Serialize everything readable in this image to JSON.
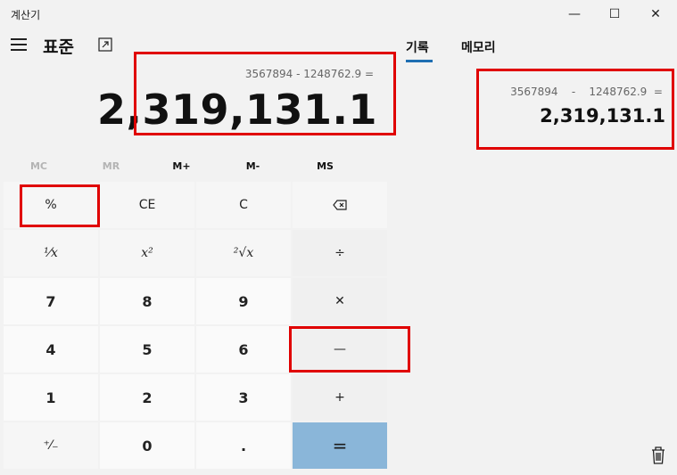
{
  "window": {
    "title": "계산기",
    "minimize": "—",
    "maximize": "☐",
    "close": "✕"
  },
  "header": {
    "mode": "표준",
    "menu_icon": "hamburger-icon",
    "keep_on_top_icon": "keep-on-top-icon"
  },
  "display": {
    "expression": "3567894 - 1248762.9 =",
    "result": "2,319,131.1"
  },
  "memory": [
    "MC",
    "MR",
    "M+",
    "M-",
    "MS"
  ],
  "keys": {
    "percent": "%",
    "ce": "CE",
    "c": "C",
    "backspace": "⌫",
    "reciprocal": "¹⁄x",
    "square": "x²",
    "sqrt": "²√x",
    "divide": "÷",
    "seven": "7",
    "eight": "8",
    "nine": "9",
    "multiply": "✕",
    "four": "4",
    "five": "5",
    "six": "6",
    "minus": "—",
    "one": "1",
    "two": "2",
    "three": "3",
    "plus": "+",
    "negate": "⁺⁄₋",
    "zero": "0",
    "decimal": ".",
    "equals": "="
  },
  "side": {
    "tabs": [
      "기록",
      "메모리"
    ],
    "history": {
      "expression": "3567894    -    1248762.9  =",
      "result": "2,319,131.1"
    },
    "delete_icon": "trash-icon"
  },
  "colors": {
    "equals_key": "#8ab6d9",
    "accent": "#1f6fb2",
    "highlight": "#e00000"
  }
}
